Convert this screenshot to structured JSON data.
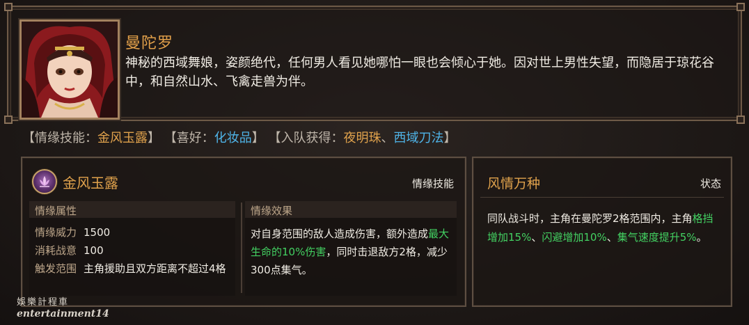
{
  "character": {
    "name": "曼陀罗",
    "description": "神秘的西域舞娘，姿颜绝代，任何男人看见她哪怕一眼也会倾心于她。因对世上男性失望，而隐居于琼花谷中，和自然山水、飞禽走兽为伴。"
  },
  "info_line": {
    "skill_label": "【情缘技能：",
    "skill_value": "金风玉露",
    "skill_end": "】",
    "hobby_label": "【喜好：",
    "hobby_value": "化妆品",
    "hobby_end": "】",
    "join_label": "【入队获得：",
    "join_item1": "夜明珠",
    "join_sep": "、",
    "join_item2": "西域刀法",
    "join_end": "】"
  },
  "skill": {
    "title": "金风玉露",
    "type": "情缘技能",
    "attr_header": "情缘属性",
    "attrs": [
      {
        "key": "情缘威力",
        "value": "1500"
      },
      {
        "key": "消耗战意",
        "value": "100"
      },
      {
        "key": "触发范围",
        "value": "主角援助且双方距离不超过4格"
      }
    ],
    "effect_header": "情缘效果",
    "effect_part1": "对自身范围的敌人造成伤害，额外造成",
    "effect_highlight": "最大生命的10%伤害",
    "effect_part2": "，同时击退敌方2格，减少300点集气。"
  },
  "state": {
    "title": "风情万种",
    "type": "状态",
    "desc_part1": "同队战斗时，主角在曼陀罗2格范围内，主角",
    "hl1": "格挡增加15%",
    "sep1": "、",
    "hl2": "闪避增加10%",
    "sep2": "、",
    "hl3": "集气速度提升5%",
    "end": "。"
  },
  "watermark": {
    "line1": "娛樂計程車",
    "line2": "entertainment14"
  },
  "colors": {
    "gold": "#e0a24c",
    "blue": "#4fb4e8",
    "green": "#43d162",
    "frame": "#6e5a47"
  }
}
